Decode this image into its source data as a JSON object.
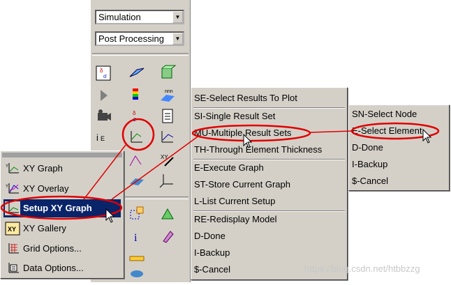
{
  "toolbar": {
    "combo1": "Simulation",
    "combo2": "Post Processing"
  },
  "xy_menu": {
    "items": [
      {
        "label": "XY Graph",
        "icon": "xy-graph-icon"
      },
      {
        "label": "XY Overlay",
        "icon": "xy-overlay-icon"
      },
      {
        "label": "Setup XY Graph",
        "icon": "setup-xy-graph-icon"
      },
      {
        "label": "XY Gallery",
        "icon": "xy-gallery-icon"
      },
      {
        "label": "Grid Options...",
        "icon": "grid-options-icon"
      },
      {
        "label": "Data Options...",
        "icon": "data-options-icon"
      }
    ],
    "selected_index": 2
  },
  "setup_menu": {
    "items": [
      "SE-Select Results To Plot",
      "SI-Single Result Set",
      "MU-Multiple Result Sets",
      "TH-Through Element Thickness",
      "E-Execute Graph",
      "ST-Store Current Graph",
      "L-List Current Setup",
      "RE-Redisplay Model",
      "D-Done",
      "I-Backup",
      "$-Cancel"
    ]
  },
  "select_menu": {
    "items": [
      "SN-Select Node",
      "E-Select Element",
      "D-Done",
      "I-Backup",
      "$-Cancel"
    ]
  },
  "watermark": "https://blog.csdn.net/htbbzzg",
  "colors": {
    "highlight": "#0a246a",
    "annotation": "#e00000",
    "face": "#d4d0c8"
  }
}
